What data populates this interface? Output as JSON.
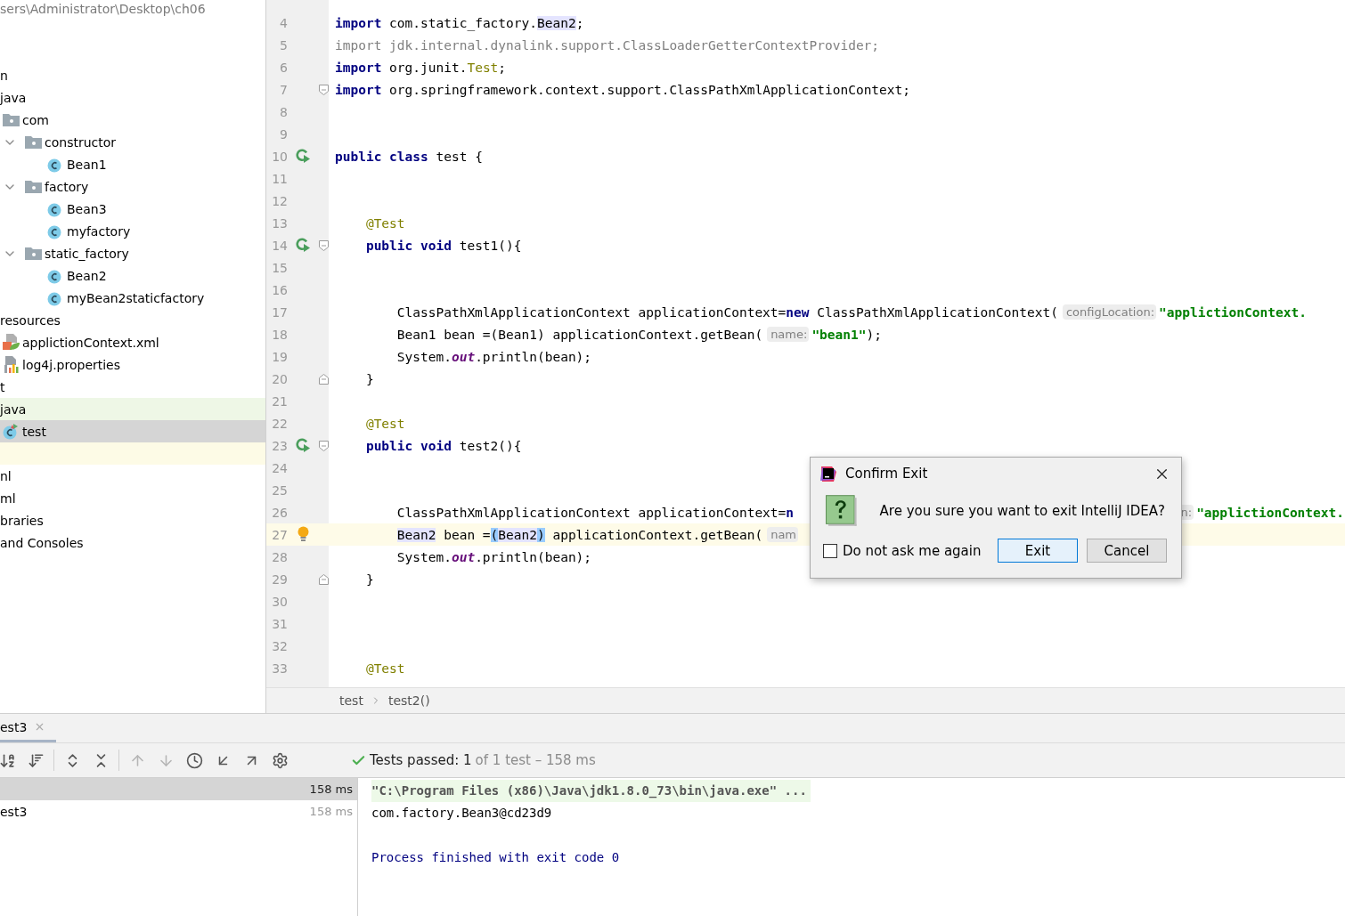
{
  "project_tree": {
    "path": "sers\\Administrator\\Desktop\\ch06",
    "items": [
      {
        "kind": "node",
        "label": "n",
        "selected": false,
        "highlighted": false
      },
      {
        "kind": "node",
        "label": "java",
        "selected": false,
        "highlighted": false,
        "children": [
          {
            "label": "com",
            "kind": "folder",
            "selected": false,
            "highlighted": false,
            "children": [
              {
                "label": "constructor",
                "kind": "folder",
                "expanded": true,
                "selected": false,
                "highlighted": false,
                "children": [
                  {
                    "label": "Bean1",
                    "kind": "class",
                    "selected": false,
                    "highlighted": false
                  }
                ]
              },
              {
                "label": "factory",
                "kind": "folder",
                "expanded": true,
                "selected": false,
                "highlighted": false,
                "children": [
                  {
                    "label": "Bean3",
                    "kind": "class",
                    "selected": false,
                    "highlighted": false
                  },
                  {
                    "label": "myfactory",
                    "kind": "class",
                    "selected": false,
                    "highlighted": false
                  }
                ]
              },
              {
                "label": "static_factory",
                "kind": "folder",
                "expanded": true,
                "selected": false,
                "highlighted": false,
                "children": [
                  {
                    "label": "Bean2",
                    "kind": "class",
                    "selected": false,
                    "highlighted": false
                  },
                  {
                    "label": "myBean2staticfactory",
                    "kind": "class",
                    "selected": false,
                    "highlighted": false
                  }
                ]
              }
            ]
          }
        ]
      },
      {
        "kind": "node",
        "label": "resources",
        "selected": false,
        "highlighted": false,
        "children": [
          {
            "label": "applictionContext.xml",
            "kind": "xml",
            "selected": false,
            "highlighted": false
          },
          {
            "label": "log4j.properties",
            "kind": "properties",
            "selected": false,
            "highlighted": false
          }
        ]
      },
      {
        "kind": "node",
        "label": "t",
        "selected": false,
        "highlighted": false
      },
      {
        "kind": "node",
        "label": "java",
        "selected": false,
        "highlighted": true,
        "children": [
          {
            "label": "test",
            "kind": "test-class",
            "selected": true,
            "highlighted": false
          }
        ]
      },
      {
        "kind": "blank"
      },
      {
        "kind": "node",
        "label": "nl",
        "selected": false,
        "highlighted": false
      },
      {
        "kind": "node",
        "label": "ml",
        "selected": false,
        "highlighted": false
      },
      {
        "kind": "node",
        "label": "braries",
        "selected": false,
        "highlighted": false
      },
      {
        "kind": "node",
        "label": "and Consoles",
        "selected": false,
        "highlighted": false
      }
    ]
  },
  "editor": {
    "lines": [
      {
        "number": "4",
        "current": false,
        "run": false,
        "bulb": false,
        "fold_open": false,
        "fold_close": false,
        "tokens": [
          {
            "kind": "keyword",
            "text": "import"
          },
          {
            "kind": "plain",
            "text": " com.static_factory."
          },
          {
            "kind": "usage",
            "text": "Bean2"
          },
          {
            "kind": "plain",
            "text": ";"
          }
        ]
      },
      {
        "number": "5",
        "current": false,
        "run": false,
        "bulb": false,
        "fold_open": false,
        "fold_close": false,
        "tokens": [
          {
            "kind": "unused",
            "text": "import jdk.internal.dynalink.support.ClassLoaderGetterContextProvider;"
          }
        ]
      },
      {
        "number": "6",
        "current": false,
        "run": false,
        "bulb": false,
        "fold_open": false,
        "fold_close": false,
        "tokens": [
          {
            "kind": "keyword",
            "text": "import"
          },
          {
            "kind": "plain",
            "text": " org.junit."
          },
          {
            "kind": "annotation",
            "text": "Test"
          },
          {
            "kind": "plain",
            "text": ";"
          }
        ]
      },
      {
        "number": "7",
        "current": false,
        "run": false,
        "bulb": false,
        "fold_open": true,
        "fold_close": false,
        "tokens": [
          {
            "kind": "keyword",
            "text": "import"
          },
          {
            "kind": "plain",
            "text": " org.springframework.context.support.ClassPathXmlApplicationContext;"
          }
        ]
      },
      {
        "number": "8",
        "current": false,
        "run": false,
        "bulb": false,
        "fold_open": false,
        "fold_close": false
      },
      {
        "number": "9",
        "current": false,
        "run": false,
        "bulb": false,
        "fold_open": false,
        "fold_close": false
      },
      {
        "number": "10",
        "current": false,
        "run": true,
        "bulb": false,
        "fold_open": false,
        "fold_close": false,
        "tokens": [
          {
            "kind": "keyword",
            "text": "public class"
          },
          {
            "kind": "plain",
            "text": " test {"
          }
        ]
      },
      {
        "number": "11",
        "current": false,
        "run": false,
        "bulb": false,
        "fold_open": false,
        "fold_close": false
      },
      {
        "number": "12",
        "current": false,
        "run": false,
        "bulb": false,
        "fold_open": false,
        "fold_close": false
      },
      {
        "number": "13",
        "current": false,
        "run": false,
        "bulb": false,
        "fold_open": false,
        "fold_close": false,
        "tokens": [
          {
            "kind": "indent"
          },
          {
            "kind": "annotation",
            "text": "@Test"
          }
        ]
      },
      {
        "number": "14",
        "current": false,
        "run": true,
        "bulb": false,
        "fold_open": true,
        "fold_close": false,
        "tokens": [
          {
            "kind": "indent"
          },
          {
            "kind": "keyword",
            "text": "public void"
          },
          {
            "kind": "plain",
            "text": " test1(){"
          }
        ]
      },
      {
        "number": "15",
        "current": false,
        "run": false,
        "bulb": false,
        "fold_open": false,
        "fold_close": false
      },
      {
        "number": "16",
        "current": false,
        "run": false,
        "bulb": false,
        "fold_open": false,
        "fold_close": false
      },
      {
        "number": "17",
        "current": false,
        "run": false,
        "bulb": false,
        "fold_open": false,
        "fold_close": false,
        "tokens": [
          {
            "kind": "indent"
          },
          {
            "kind": "indent"
          },
          {
            "kind": "plain",
            "text": "ClassPathXmlApplicationContext applicationContext="
          },
          {
            "kind": "keyword",
            "text": "new"
          },
          {
            "kind": "plain",
            "text": " ClassPathXmlApplicationContext("
          },
          {
            "kind": "hint",
            "text": "configLocation:"
          },
          {
            "kind": "string",
            "text": "\"applictionContext."
          }
        ]
      },
      {
        "number": "18",
        "current": false,
        "run": false,
        "bulb": false,
        "fold_open": false,
        "fold_close": false,
        "tokens": [
          {
            "kind": "indent"
          },
          {
            "kind": "indent"
          },
          {
            "kind": "plain",
            "text": "Bean1 bean =(Bean1) applicationContext.getBean("
          },
          {
            "kind": "hint",
            "text": "name:"
          },
          {
            "kind": "string",
            "text": "\"bean1\""
          },
          {
            "kind": "plain",
            "text": ");"
          }
        ]
      },
      {
        "number": "19",
        "current": false,
        "run": false,
        "bulb": false,
        "fold_open": false,
        "fold_close": false,
        "tokens": [
          {
            "kind": "indent"
          },
          {
            "kind": "indent"
          },
          {
            "kind": "plain",
            "text": "System."
          },
          {
            "kind": "field",
            "text": "out"
          },
          {
            "kind": "plain",
            "text": ".println(bean);"
          }
        ]
      },
      {
        "number": "20",
        "current": false,
        "run": false,
        "bulb": false,
        "fold_open": false,
        "fold_close": true,
        "tokens": [
          {
            "kind": "indent"
          },
          {
            "kind": "plain",
            "text": "}"
          }
        ]
      },
      {
        "number": "21",
        "current": false,
        "run": false,
        "bulb": false,
        "fold_open": false,
        "fold_close": false
      },
      {
        "number": "22",
        "current": false,
        "run": false,
        "bulb": false,
        "fold_open": false,
        "fold_close": false,
        "tokens": [
          {
            "kind": "indent"
          },
          {
            "kind": "annotation",
            "text": "@Test"
          }
        ]
      },
      {
        "number": "23",
        "current": false,
        "run": true,
        "bulb": false,
        "fold_open": true,
        "fold_close": false,
        "tokens": [
          {
            "kind": "indent"
          },
          {
            "kind": "keyword",
            "text": "public void"
          },
          {
            "kind": "plain",
            "text": " test2(){"
          }
        ]
      },
      {
        "number": "24",
        "current": false,
        "run": false,
        "bulb": false,
        "fold_open": false,
        "fold_close": false
      },
      {
        "number": "25",
        "current": false,
        "run": false,
        "bulb": false,
        "fold_open": false,
        "fold_close": false
      },
      {
        "number": "26",
        "current": false,
        "run": false,
        "bulb": false,
        "fold_open": false,
        "fold_close": false,
        "tokens": [
          {
            "kind": "indent"
          },
          {
            "kind": "indent"
          },
          {
            "kind": "plain",
            "text": "ClassPathXmlApplicationContext applicationContext="
          },
          {
            "kind": "keyword",
            "text": "n"
          },
          {
            "kind": "gap"
          },
          {
            "kind": "hint",
            "text": "n:"
          },
          {
            "kind": "string",
            "text": "\"applictionContext."
          }
        ]
      },
      {
        "number": "27",
        "current": true,
        "run": false,
        "bulb": true,
        "fold_open": false,
        "fold_close": false,
        "tokens": [
          {
            "kind": "indent"
          },
          {
            "kind": "indent"
          },
          {
            "kind": "usage",
            "text": "Bean2"
          },
          {
            "kind": "plain",
            "text": " bean ="
          },
          {
            "kind": "match",
            "text": "("
          },
          {
            "kind": "usage",
            "text": "Bean2"
          },
          {
            "kind": "match",
            "text": ")"
          },
          {
            "kind": "plain",
            "text": " applicationContext.getBean("
          },
          {
            "kind": "hint",
            "text": "nam"
          }
        ]
      },
      {
        "number": "28",
        "current": false,
        "run": false,
        "bulb": false,
        "fold_open": false,
        "fold_close": false,
        "tokens": [
          {
            "kind": "indent"
          },
          {
            "kind": "indent"
          },
          {
            "kind": "plain",
            "text": "System."
          },
          {
            "kind": "field",
            "text": "out"
          },
          {
            "kind": "plain",
            "text": ".println(bean);"
          }
        ]
      },
      {
        "number": "29",
        "current": false,
        "run": false,
        "bulb": false,
        "fold_open": false,
        "fold_close": true,
        "tokens": [
          {
            "kind": "indent"
          },
          {
            "kind": "plain",
            "text": "}"
          }
        ]
      },
      {
        "number": "30",
        "current": false,
        "run": false,
        "bulb": false,
        "fold_open": false,
        "fold_close": false
      },
      {
        "number": "31",
        "current": false,
        "run": false,
        "bulb": false,
        "fold_open": false,
        "fold_close": false
      },
      {
        "number": "32",
        "current": false,
        "run": false,
        "bulb": false,
        "fold_open": false,
        "fold_close": false
      },
      {
        "number": "33",
        "current": false,
        "run": false,
        "bulb": false,
        "fold_open": false,
        "fold_close": false,
        "tokens": [
          {
            "kind": "indent"
          },
          {
            "kind": "annotation",
            "text": "@Test"
          }
        ]
      }
    ],
    "breadcrumbs": [
      "test",
      "test2()"
    ]
  },
  "run_panel": {
    "tabs": [
      {
        "label": "est3",
        "selected": true
      }
    ],
    "toolbar": [
      {
        "kind": "sort-alpha",
        "disabled": false
      },
      {
        "kind": "sort-duration",
        "disabled": false
      },
      {
        "kind": "expand-all",
        "disabled": false
      },
      {
        "kind": "collapse-all",
        "disabled": false
      },
      {
        "kind": "previous",
        "disabled": true
      },
      {
        "kind": "next",
        "disabled": true
      },
      {
        "kind": "history",
        "disabled": false
      },
      {
        "kind": "import",
        "disabled": false
      },
      {
        "kind": "export",
        "disabled": false
      },
      {
        "kind": "settings",
        "disabled": false
      }
    ],
    "status": {
      "passed": "Tests passed: 1",
      "detail": "of 1 test – 158 ms"
    },
    "results": [
      {
        "duration": "158 ms",
        "selected": true
      },
      {
        "name": "est3",
        "duration": "158 ms",
        "selected": false
      }
    ],
    "console": [
      {
        "kind": "command",
        "text": "\"C:\\Program Files (x86)\\Java\\jdk1.8.0_73\\bin\\java.exe\" ..."
      },
      {
        "kind": "output",
        "text": "com.factory.Bean3@cd23d9"
      },
      {
        "kind": "blank"
      },
      {
        "kind": "system",
        "text": "Process finished with exit code 0"
      }
    ]
  },
  "dialog": {
    "title": "Confirm Exit",
    "message": "Are you sure you want to exit IntelliJ IDEA?",
    "checkbox": {
      "label": "Do not ask me again",
      "checked": false
    },
    "buttons": [
      {
        "label": "Exit",
        "default": true
      },
      {
        "label": "Cancel",
        "default": false
      }
    ]
  }
}
